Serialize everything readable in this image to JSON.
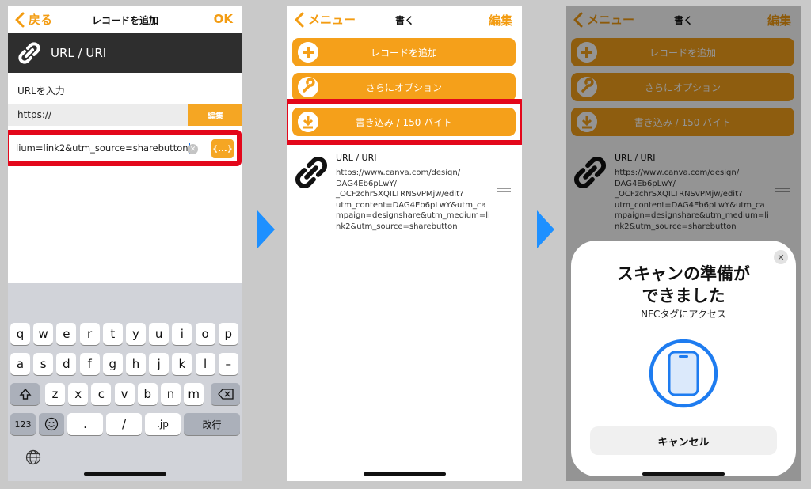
{
  "colors": {
    "accent": "#f5a01a",
    "highlight": "#e3071b",
    "arrow": "#1e90ff",
    "nfc_blue": "#1e7cf0"
  },
  "panel1": {
    "back_label": "戻る",
    "title": "レコードを追加",
    "ok_label": "OK",
    "record_type": "URL / URI",
    "section_label": "URLを入力",
    "url_prefix": "https://",
    "edit_label": "編集",
    "input_value": "lium=link2&utm_source=sharebutton",
    "brace_label": "{...}",
    "keyboard": {
      "row1": [
        "q",
        "w",
        "e",
        "r",
        "t",
        "y",
        "u",
        "i",
        "o",
        "p"
      ],
      "row2": [
        "a",
        "s",
        "d",
        "f",
        "g",
        "h",
        "j",
        "k",
        "l",
        "–"
      ],
      "row3": [
        "z",
        "x",
        "c",
        "v",
        "b",
        "n",
        "m"
      ],
      "num_key": "123",
      "dot_key": ".",
      "slash_key": "/",
      "jp_key": ".jp",
      "return_key": "改行"
    }
  },
  "panel2": {
    "back_label": "メニュー",
    "title": "書く",
    "edit_label": "編集",
    "buttons": {
      "add": "レコードを追加",
      "options": "さらにオプション",
      "write": "書き込み / 150 バイト"
    },
    "record": {
      "type": "URL / URI",
      "lines": [
        "https://www.canva.com/design/",
        "DAG4Eb6pLwY/",
        "_OCFzchrSXQILTRNSvPMjw/edit?",
        "utm_content=DAG4Eb6pLwY&utm_ca",
        "mpaign=designshare&utm_medium=li",
        "nk2&utm_source=sharebutton"
      ]
    }
  },
  "panel3": {
    "sheet": {
      "title_line1": "スキャンの準備が",
      "title_line2": "できました",
      "subtitle": "NFCタグにアクセス",
      "cancel_label": "キャンセル"
    }
  }
}
